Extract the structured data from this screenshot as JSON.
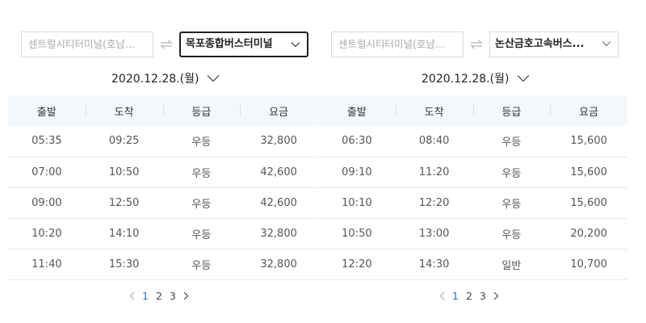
{
  "panels": [
    {
      "origin": "센트럴시티터미널(호남...",
      "destination": "목포종합버스터미널",
      "date": "2020.12.28.(월)",
      "columns": [
        "출발",
        "도착",
        "등급",
        "요금"
      ],
      "rows": [
        [
          "05:35",
          "09:25",
          "우등",
          "32,800"
        ],
        [
          "07:00",
          "10:50",
          "우등",
          "42,600"
        ],
        [
          "09:00",
          "12:50",
          "우등",
          "42,600"
        ],
        [
          "10:20",
          "14:10",
          "우등",
          "32,800"
        ],
        [
          "11:40",
          "15:30",
          "우등",
          "32,800"
        ]
      ],
      "pages": [
        "1",
        "2",
        "3"
      ],
      "current_page": "1"
    },
    {
      "origin": "센트럴시티터미널(호남...",
      "destination": "논산금호고속버스...",
      "date": "2020.12.28.(월)",
      "columns": [
        "출발",
        "도착",
        "등급",
        "요금"
      ],
      "rows": [
        [
          "06:30",
          "08:40",
          "우등",
          "15,600"
        ],
        [
          "09:10",
          "11:20",
          "우등",
          "15,600"
        ],
        [
          "10:10",
          "12:20",
          "우등",
          "15,600"
        ],
        [
          "10:50",
          "13:00",
          "우등",
          "20,200"
        ],
        [
          "12:20",
          "14:30",
          "일반",
          "10,700"
        ]
      ],
      "pages": [
        "1",
        "2",
        "3"
      ],
      "current_page": "1"
    }
  ],
  "icons": {
    "swap": "swap-arrows-icon",
    "dropdown": "chevron-down-icon",
    "prev": "chevron-left-icon",
    "next": "chevron-right-icon"
  },
  "colors": {
    "header_bg": "#f4f8fb",
    "current_page": "#1f6fd1",
    "active_border": "#222222"
  }
}
